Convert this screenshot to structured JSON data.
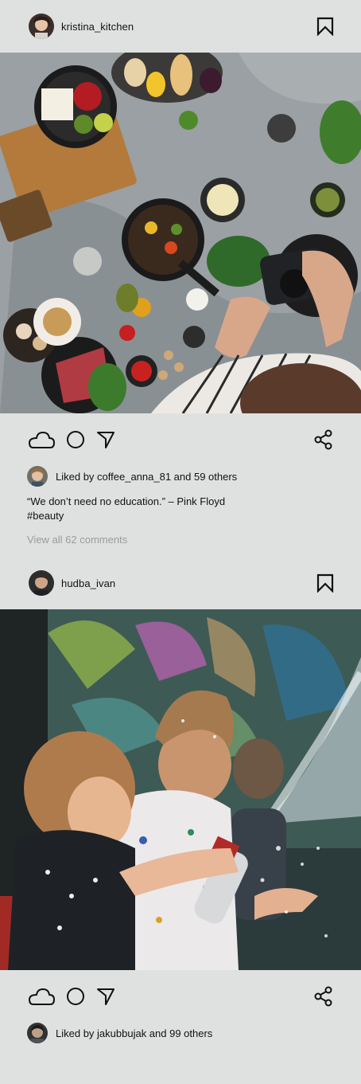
{
  "posts": [
    {
      "username": "kristina_kitchen",
      "image_description": "Overhead kitchen table with bowls of fruit, vegetables, eggs, spices and a photographer's hands holding a camera",
      "liked_by": "coffee_anna_81",
      "likes_text": "Liked by coffee_anna_81 and 59 others",
      "caption_line1": "“We don’t need no education.” – Pink Floyd",
      "caption_line2": "#beauty",
      "comments_link": "View all 62 comments"
    },
    {
      "username": "hudba_ivan",
      "image_description": "Children playing with a spray of water in front of a graffiti wall",
      "liked_by": "jakubbujak",
      "likes_text": "Liked by jakubbujak and 99 others"
    }
  ],
  "icons": {
    "like": "cloud-icon",
    "comment": "circle-icon",
    "send": "send-arrow-icon",
    "save": "bookmark-icon",
    "share": "share-icon"
  },
  "colors": {
    "background": "#dfe1e0",
    "text": "#111111",
    "muted_text": "#9a9c9c"
  }
}
